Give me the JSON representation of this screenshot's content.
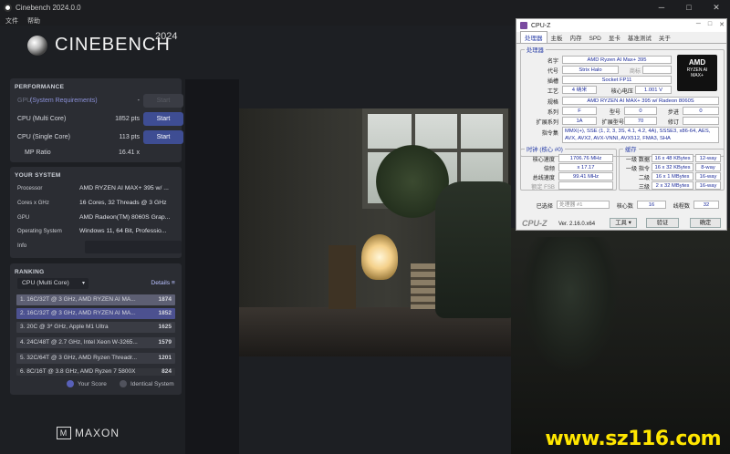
{
  "window": {
    "title": "Cinebench 2024.0.0",
    "menu": [
      "文件",
      "帮助"
    ]
  },
  "logo": {
    "name": "CINEBENCH",
    "version": "2024"
  },
  "performance": {
    "title": "PERFORMANCE",
    "gpu_label": "GPU",
    "gpu_req": "(System Requirements)",
    "gpu_value": "-",
    "rows": [
      {
        "label": "CPU (Multi Core)",
        "value": "1852 pts",
        "button": "Start"
      },
      {
        "label": "CPU (Single Core)",
        "value": "113 pts",
        "button": "Start"
      }
    ],
    "gpu_button": "Start",
    "mp_label": "MP Ratio",
    "mp_value": "16.41 x"
  },
  "system": {
    "title": "YOUR SYSTEM",
    "rows": [
      {
        "k": "Processor",
        "v": "AMD RYZEN AI MAX+ 395 w/ ..."
      },
      {
        "k": "Cores x GHz",
        "v": "16 Cores, 32 Threads @ 3 GHz"
      },
      {
        "k": "GPU",
        "v": "AMD Radeon(TM) 8060S Grap..."
      },
      {
        "k": "Operating System",
        "v": "Windows 11, 64 Bit, Professio..."
      },
      {
        "k": "Info",
        "v": ""
      }
    ]
  },
  "ranking": {
    "title": "RANKING",
    "selected": "CPU (Multi Core)",
    "details": "Details",
    "rows": [
      {
        "t": "1. 16C/32T @ 3 GHz, AMD RYZEN AI MA...",
        "s": "1874"
      },
      {
        "t": "2. 16C/32T @ 3 GHz, AMD RYZEN AI MA...",
        "s": "1852"
      },
      {
        "t": "3. 20C @ 3* GHz, Apple M1 Ultra",
        "s": "1625"
      },
      {
        "t": "4. 24C/48T @ 2.7 GHz, Intel Xeon W-3265...",
        "s": "1579"
      },
      {
        "t": "5. 32C/64T @ 3 GHz, AMD Ryzen Threadr...",
        "s": "1201"
      },
      {
        "t": "6. 8C/16T @ 3.8 GHz, AMD Ryzen 7 5800X",
        "s": "824"
      }
    ],
    "legend_your": "Your Score",
    "legend_identical": "Identical System"
  },
  "brand": "MAXON",
  "watermark": "www.sz116.com",
  "cpuz": {
    "title": "CPU-Z",
    "tabs": [
      "处理器",
      "主板",
      "内存",
      "SPD",
      "显卡",
      "基准测试",
      "关于"
    ],
    "grp_processor": "处理器",
    "name_k": "名字",
    "name_v": "AMD Ryzen AI Max+ 395",
    "code_k": "代号",
    "code_v": "Strix Halo",
    "brand_k": "商标",
    "socket_k": "插槽",
    "socket_v": "Socket FP11",
    "tech_k": "工艺",
    "tech_v": "4 纳米",
    "volt_k": "核心电压",
    "volt_v": "1.001 V",
    "spec_k": "规格",
    "spec_v": "AMD RYZEN AI MAX+ 395 w/ Radeon 8060S",
    "family_k": "系列",
    "family_v": "F",
    "model_k": "型号",
    "model_v": "0",
    "step_k": "步进",
    "step_v": "0",
    "extfam_k": "扩展系列",
    "extfam_v": "1A",
    "extmod_k": "扩展型号",
    "extmod_v": "70",
    "rev_k": "修订",
    "rev_v": "",
    "instr_k": "指令集",
    "instr_v": "MMX(+), SSE (1, 2, 3, 3S, 4.1, 4.2, 4A), SSSE3, x86-64, AES, AVX, AVX2, AVX-VNNI, AVX512, FMA3, SHA",
    "clock_title": "时钟 (核心 #0)",
    "core_speed_k": "核心速度",
    "core_speed_v": "1706.76 MHz",
    "mult_k": "倍频",
    "mult_v": "x 17.17",
    "bus_k": "总线速度",
    "bus_v": "99.41 MHz",
    "fsb_k": "额定 FSB",
    "cache_title": "缓存",
    "l1d_k": "一级 数据",
    "l1d_v": "16 x 48 KBytes",
    "l1d_w": "12-way",
    "l1i_k": "一级 指令",
    "l1i_v": "16 x 32 KBytes",
    "l1i_w": "8-way",
    "l2_k": "二级",
    "l2_v": "16 x 1 MBytes",
    "l2_w": "16-way",
    "l3_k": "三级",
    "l3_v": "2 x 32 MBytes",
    "l3_w": "16-way",
    "sel_k": "已选择",
    "sel_v": "处理器 #1",
    "cores_k": "核心数",
    "cores_v": "16",
    "threads_k": "线程数",
    "threads_v": "32",
    "brand": "CPU-Z",
    "version": "Ver. 2.16.0.x64",
    "tools": "工具",
    "validate": "验证",
    "ok": "确定",
    "amd_logo": "AMD",
    "amd_line1": "RYZEN AI",
    "amd_line2": "MAX+"
  }
}
